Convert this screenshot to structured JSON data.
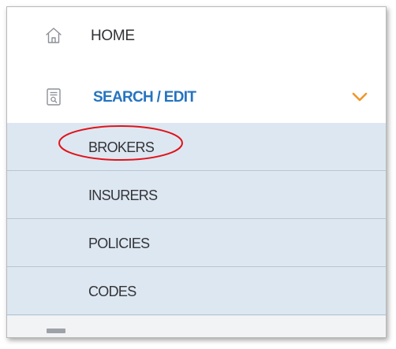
{
  "nav": {
    "home": {
      "label": "HOME",
      "icon": "home-icon"
    },
    "search_edit": {
      "label": "SEARCH / EDIT",
      "icon": "search-document-icon",
      "expanded": true,
      "chevron_icon": "chevron-down-icon"
    },
    "submenu": [
      {
        "label": "BROKERS"
      },
      {
        "label": "INSURERS"
      },
      {
        "label": "POLICIES"
      },
      {
        "label": "CODES"
      }
    ]
  },
  "annotation": {
    "shape": "ellipse",
    "target": "BROKERS",
    "color": "#e0131b"
  },
  "colors": {
    "accent_blue": "#2574c0",
    "chevron_orange": "#f0962c",
    "submenu_bg": "#dde7f1",
    "text_dark": "#2f3135"
  }
}
